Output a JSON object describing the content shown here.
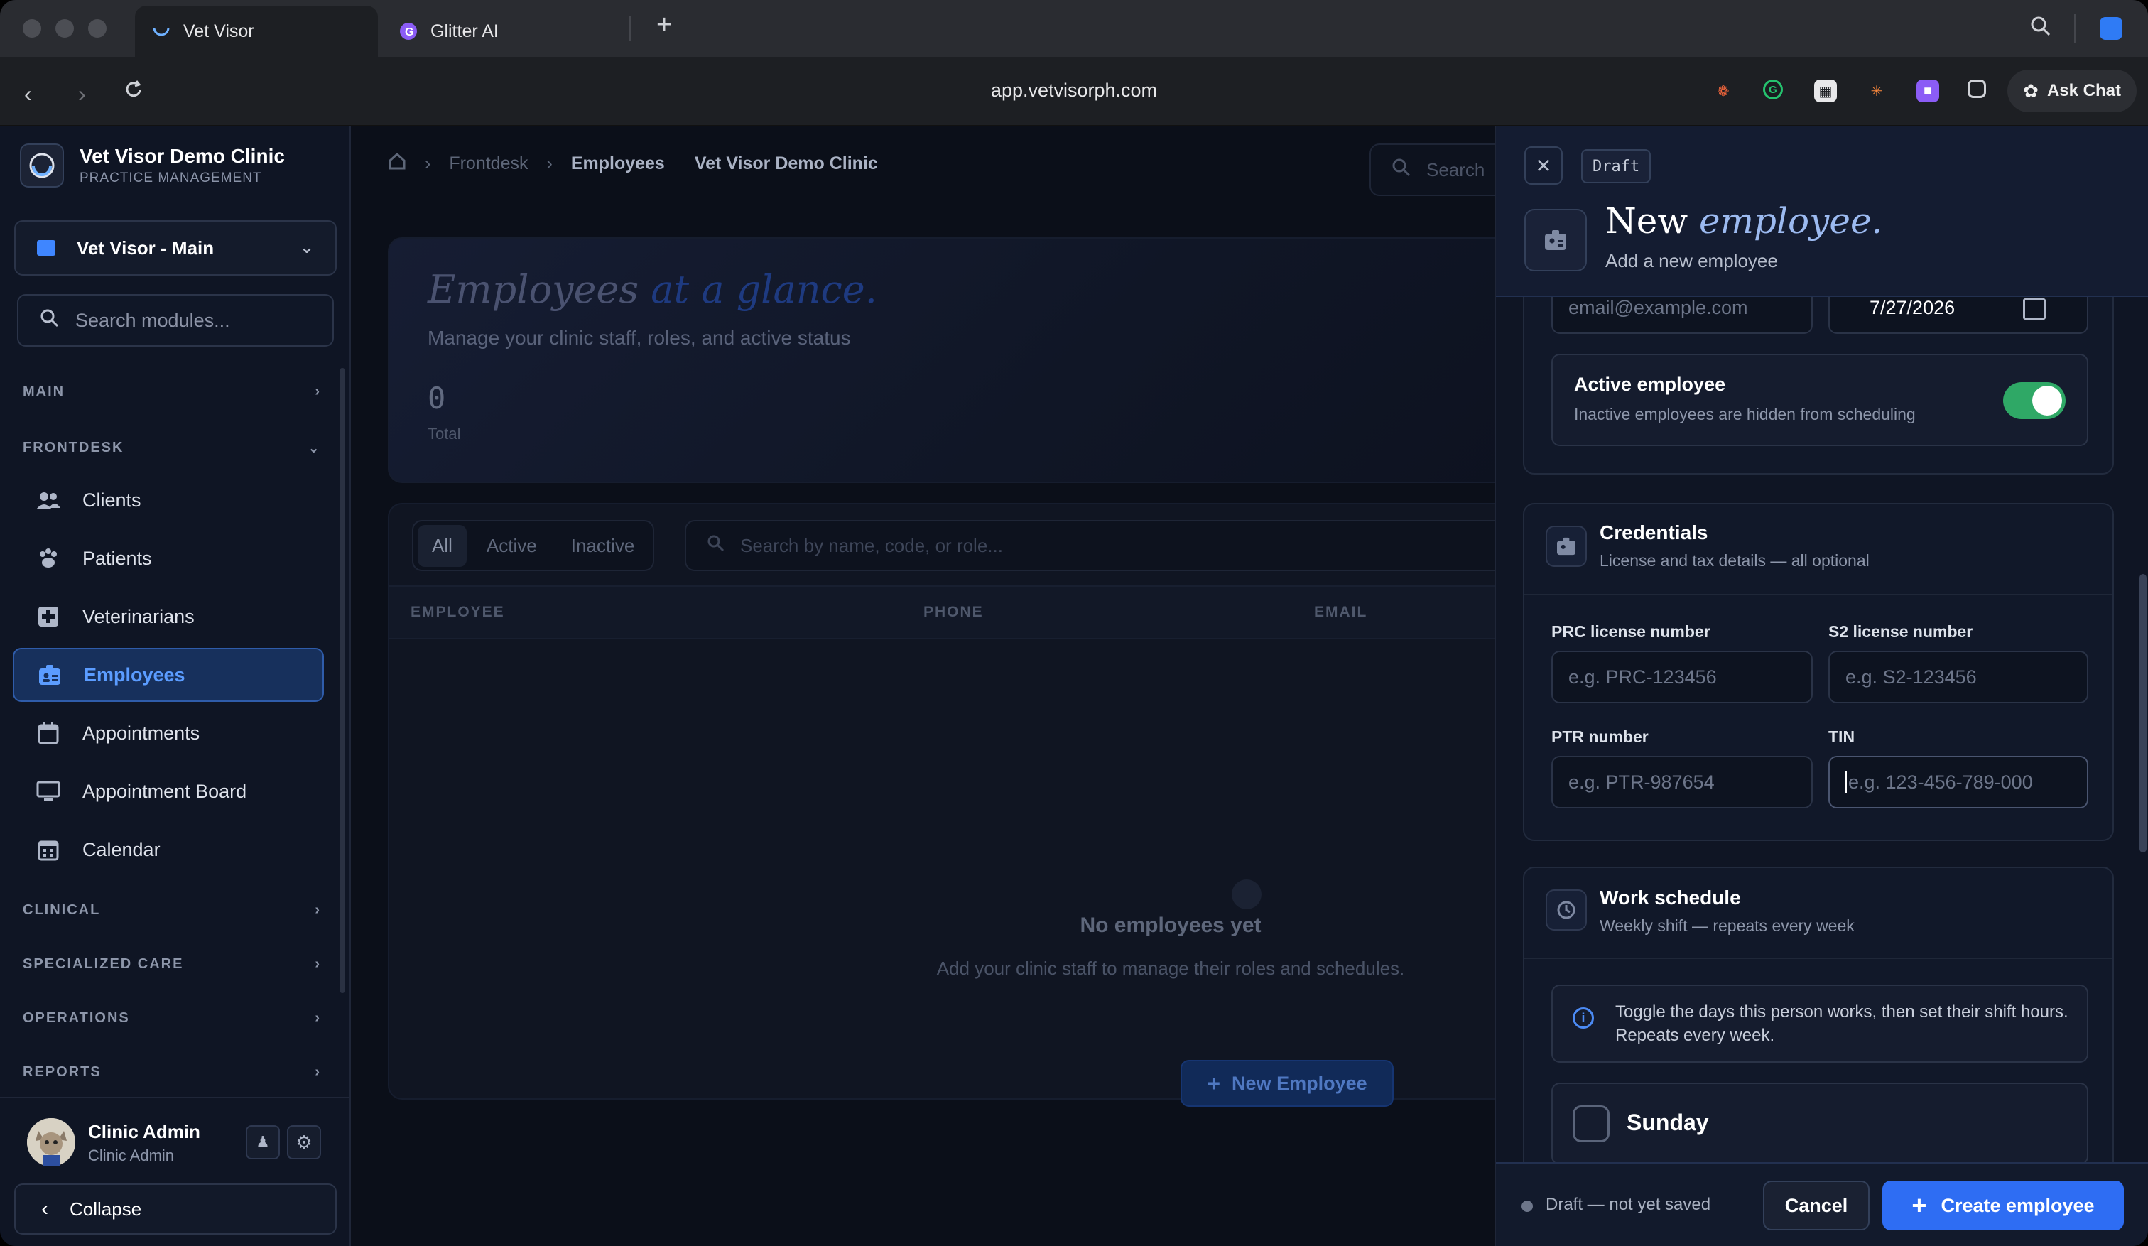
{
  "browser": {
    "tabs": [
      {
        "label": "Vet Visor"
      },
      {
        "label": "Glitter AI"
      }
    ],
    "url": "app.vetvisorph.com",
    "ask_chat": "Ask Chat"
  },
  "sidebar": {
    "clinic_name": "Vet Visor Demo Clinic",
    "clinic_sub": "PRACTICE MANAGEMENT",
    "branch": "Vet Visor - Main",
    "search_placeholder": "Search modules...",
    "sections": {
      "main": "MAIN",
      "frontdesk": "FRONTDESK",
      "clinical": "CLINICAL",
      "specialized": "SPECIALIZED CARE",
      "operations": "OPERATIONS",
      "reports": "REPORTS"
    },
    "items": [
      {
        "label": "Clients",
        "icon": "users-icon"
      },
      {
        "label": "Patients",
        "icon": "paw-icon"
      },
      {
        "label": "Veterinarians",
        "icon": "medical-cross-icon"
      },
      {
        "label": "Employees",
        "icon": "id-badge-icon"
      },
      {
        "label": "Appointments",
        "icon": "calendar-icon"
      },
      {
        "label": "Appointment Board",
        "icon": "monitor-icon"
      },
      {
        "label": "Calendar",
        "icon": "calendar-grid-icon"
      }
    ],
    "user": {
      "name": "Clinic Admin",
      "role": "Clinic Admin"
    },
    "collapse": "Collapse"
  },
  "main": {
    "breadcrumb": [
      "Frontdesk",
      "Employees"
    ],
    "clinic": "Vet Visor Demo Clinic",
    "search_placeholder": "Search",
    "hero": {
      "title_a": "Employees",
      "title_b": "at a glance.",
      "subtitle": "Manage your clinic staff, roles, and active status",
      "total_value": "0",
      "total_label": "Total"
    },
    "filters": [
      "All",
      "Active",
      "Inactive"
    ],
    "list_search_placeholder": "Search by name, code, or role...",
    "columns": [
      "EMPLOYEE",
      "PHONE",
      "EMAIL"
    ],
    "empty_title": "No employees yet",
    "empty_sub": "Add your clinic staff to manage their roles and schedules.",
    "new_button": "New Employee"
  },
  "drawer": {
    "draft_badge": "Draft",
    "title_a": "New",
    "title_b": "employee.",
    "subtitle": "Add a new employee",
    "email_placeholder": "email@example.com",
    "date_value": "7/27/2026",
    "active_title": "Active employee",
    "active_sub": "Inactive employees are hidden from scheduling",
    "active_on": true,
    "credentials": {
      "title": "Credentials",
      "subtitle": "License and tax details — all optional",
      "prc_label": "PRC license number",
      "prc_placeholder": "e.g. PRC-123456",
      "s2_label": "S2 license number",
      "s2_placeholder": "e.g. S2-123456",
      "ptr_label": "PTR number",
      "ptr_placeholder": "e.g. PTR-987654",
      "tin_label": "TIN",
      "tin_placeholder": "e.g. 123-456-789-000"
    },
    "schedule": {
      "title": "Work schedule",
      "subtitle": "Weekly shift — repeats every week",
      "info": "Toggle the days this person works, then set their shift hours. Repeats every week.",
      "day": "Sunday"
    },
    "footer": {
      "status": "Draft — not yet saved",
      "cancel": "Cancel",
      "create": "Create employee"
    }
  },
  "colors": {
    "accent": "#2e6df3",
    "toggle_on": "#2fa866",
    "selected_nav": "#5b9cff"
  }
}
